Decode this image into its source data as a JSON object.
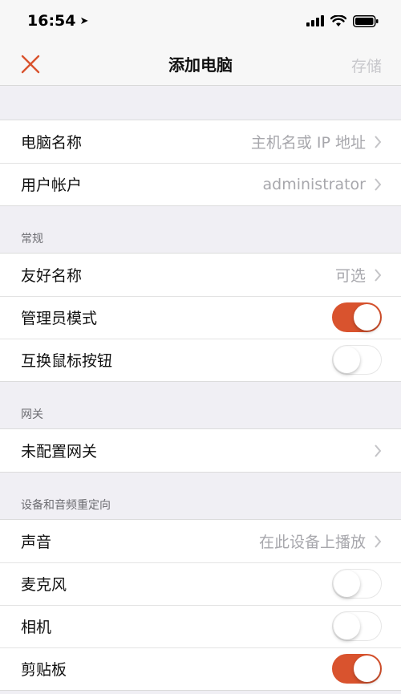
{
  "status_bar": {
    "time": "16:54"
  },
  "nav": {
    "title": "添加电脑",
    "save_label": "存储"
  },
  "group_main": [
    {
      "label": "电脑名称",
      "value": "主机名或 IP 地址"
    },
    {
      "label": "用户帐户",
      "value": "administrator"
    }
  ],
  "general": {
    "header": "常规",
    "friendly_name": {
      "label": "友好名称",
      "value": "可选"
    },
    "admin_mode": {
      "label": "管理员模式",
      "on": true
    },
    "swap_mouse": {
      "label": "互换鼠标按钮",
      "on": false
    }
  },
  "gateway": {
    "header": "网关",
    "row": {
      "label": "未配置网关"
    }
  },
  "redirection": {
    "header": "设备和音频重定向",
    "sound": {
      "label": "声音",
      "value": "在此设备上播放"
    },
    "microphone": {
      "label": "麦克风",
      "on": false
    },
    "camera": {
      "label": "相机",
      "on": false
    },
    "clipboard": {
      "label": "剪贴板",
      "on": true
    }
  },
  "colors": {
    "accent": "#d9532e",
    "secondary_text": "#a7a7ac",
    "background": "#f0eff4"
  }
}
